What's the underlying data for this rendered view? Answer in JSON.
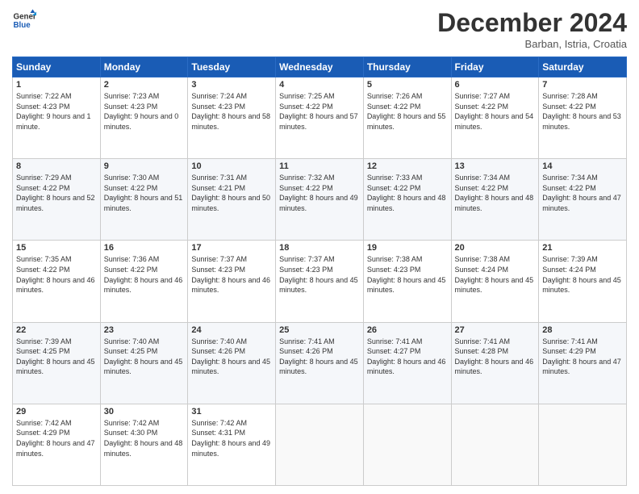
{
  "header": {
    "logo_line1": "General",
    "logo_line2": "Blue",
    "month_title": "December 2024",
    "location": "Barban, Istria, Croatia"
  },
  "weekdays": [
    "Sunday",
    "Monday",
    "Tuesday",
    "Wednesday",
    "Thursday",
    "Friday",
    "Saturday"
  ],
  "weeks": [
    [
      {
        "day": "1",
        "sunrise": "7:22 AM",
        "sunset": "4:23 PM",
        "daylight": "9 hours and 1 minute."
      },
      {
        "day": "2",
        "sunrise": "7:23 AM",
        "sunset": "4:23 PM",
        "daylight": "9 hours and 0 minutes."
      },
      {
        "day": "3",
        "sunrise": "7:24 AM",
        "sunset": "4:23 PM",
        "daylight": "8 hours and 58 minutes."
      },
      {
        "day": "4",
        "sunrise": "7:25 AM",
        "sunset": "4:22 PM",
        "daylight": "8 hours and 57 minutes."
      },
      {
        "day": "5",
        "sunrise": "7:26 AM",
        "sunset": "4:22 PM",
        "daylight": "8 hours and 55 minutes."
      },
      {
        "day": "6",
        "sunrise": "7:27 AM",
        "sunset": "4:22 PM",
        "daylight": "8 hours and 54 minutes."
      },
      {
        "day": "7",
        "sunrise": "7:28 AM",
        "sunset": "4:22 PM",
        "daylight": "8 hours and 53 minutes."
      }
    ],
    [
      {
        "day": "8",
        "sunrise": "7:29 AM",
        "sunset": "4:22 PM",
        "daylight": "8 hours and 52 minutes."
      },
      {
        "day": "9",
        "sunrise": "7:30 AM",
        "sunset": "4:22 PM",
        "daylight": "8 hours and 51 minutes."
      },
      {
        "day": "10",
        "sunrise": "7:31 AM",
        "sunset": "4:21 PM",
        "daylight": "8 hours and 50 minutes."
      },
      {
        "day": "11",
        "sunrise": "7:32 AM",
        "sunset": "4:22 PM",
        "daylight": "8 hours and 49 minutes."
      },
      {
        "day": "12",
        "sunrise": "7:33 AM",
        "sunset": "4:22 PM",
        "daylight": "8 hours and 48 minutes."
      },
      {
        "day": "13",
        "sunrise": "7:34 AM",
        "sunset": "4:22 PM",
        "daylight": "8 hours and 48 minutes."
      },
      {
        "day": "14",
        "sunrise": "7:34 AM",
        "sunset": "4:22 PM",
        "daylight": "8 hours and 47 minutes."
      }
    ],
    [
      {
        "day": "15",
        "sunrise": "7:35 AM",
        "sunset": "4:22 PM",
        "daylight": "8 hours and 46 minutes."
      },
      {
        "day": "16",
        "sunrise": "7:36 AM",
        "sunset": "4:22 PM",
        "daylight": "8 hours and 46 minutes."
      },
      {
        "day": "17",
        "sunrise": "7:37 AM",
        "sunset": "4:23 PM",
        "daylight": "8 hours and 46 minutes."
      },
      {
        "day": "18",
        "sunrise": "7:37 AM",
        "sunset": "4:23 PM",
        "daylight": "8 hours and 45 minutes."
      },
      {
        "day": "19",
        "sunrise": "7:38 AM",
        "sunset": "4:23 PM",
        "daylight": "8 hours and 45 minutes."
      },
      {
        "day": "20",
        "sunrise": "7:38 AM",
        "sunset": "4:24 PM",
        "daylight": "8 hours and 45 minutes."
      },
      {
        "day": "21",
        "sunrise": "7:39 AM",
        "sunset": "4:24 PM",
        "daylight": "8 hours and 45 minutes."
      }
    ],
    [
      {
        "day": "22",
        "sunrise": "7:39 AM",
        "sunset": "4:25 PM",
        "daylight": "8 hours and 45 minutes."
      },
      {
        "day": "23",
        "sunrise": "7:40 AM",
        "sunset": "4:25 PM",
        "daylight": "8 hours and 45 minutes."
      },
      {
        "day": "24",
        "sunrise": "7:40 AM",
        "sunset": "4:26 PM",
        "daylight": "8 hours and 45 minutes."
      },
      {
        "day": "25",
        "sunrise": "7:41 AM",
        "sunset": "4:26 PM",
        "daylight": "8 hours and 45 minutes."
      },
      {
        "day": "26",
        "sunrise": "7:41 AM",
        "sunset": "4:27 PM",
        "daylight": "8 hours and 46 minutes."
      },
      {
        "day": "27",
        "sunrise": "7:41 AM",
        "sunset": "4:28 PM",
        "daylight": "8 hours and 46 minutes."
      },
      {
        "day": "28",
        "sunrise": "7:41 AM",
        "sunset": "4:29 PM",
        "daylight": "8 hours and 47 minutes."
      }
    ],
    [
      {
        "day": "29",
        "sunrise": "7:42 AM",
        "sunset": "4:29 PM",
        "daylight": "8 hours and 47 minutes."
      },
      {
        "day": "30",
        "sunrise": "7:42 AM",
        "sunset": "4:30 PM",
        "daylight": "8 hours and 48 minutes."
      },
      {
        "day": "31",
        "sunrise": "7:42 AM",
        "sunset": "4:31 PM",
        "daylight": "8 hours and 49 minutes."
      },
      null,
      null,
      null,
      null
    ]
  ]
}
